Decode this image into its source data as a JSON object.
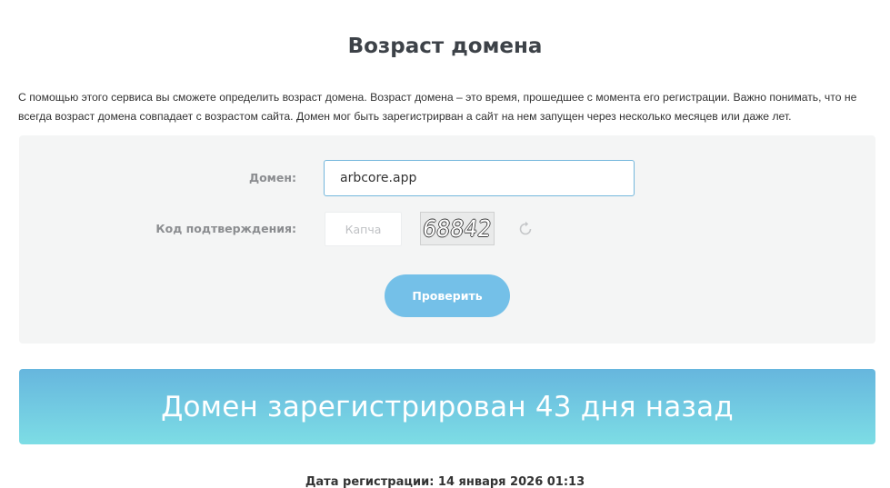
{
  "page": {
    "title": "Возраст домена",
    "intro": "С помощью этого сервиса вы сможете определить возраст домена. Возраст домена – это время, прошедшее с момента его регистрации. Важно понимать, что не всегда возраст домена совпадает с возрастом сайта. Домен мог быть зарегистрирван а сайт на нем запущен через несколько месяцев или даже лет."
  },
  "form": {
    "domain_label": "Домен:",
    "domain_value": "arbcore.app",
    "code_label": "Код подтверждения:",
    "captcha_placeholder": "Капча",
    "captcha_text": "68842",
    "refresh_icon": "refresh-icon",
    "check_button": "Проверить"
  },
  "result": {
    "message": "Домен зарегистрирован 43 дня назад",
    "registration_date": "Дата регистрации: 14 января 2026 01:13"
  },
  "colors": {
    "accent": "#74c0e8",
    "banner_top": "#66b6de",
    "banner_bottom": "#7ddde5",
    "panel_bg": "#f4f5f5",
    "label": "#8b8d90"
  }
}
